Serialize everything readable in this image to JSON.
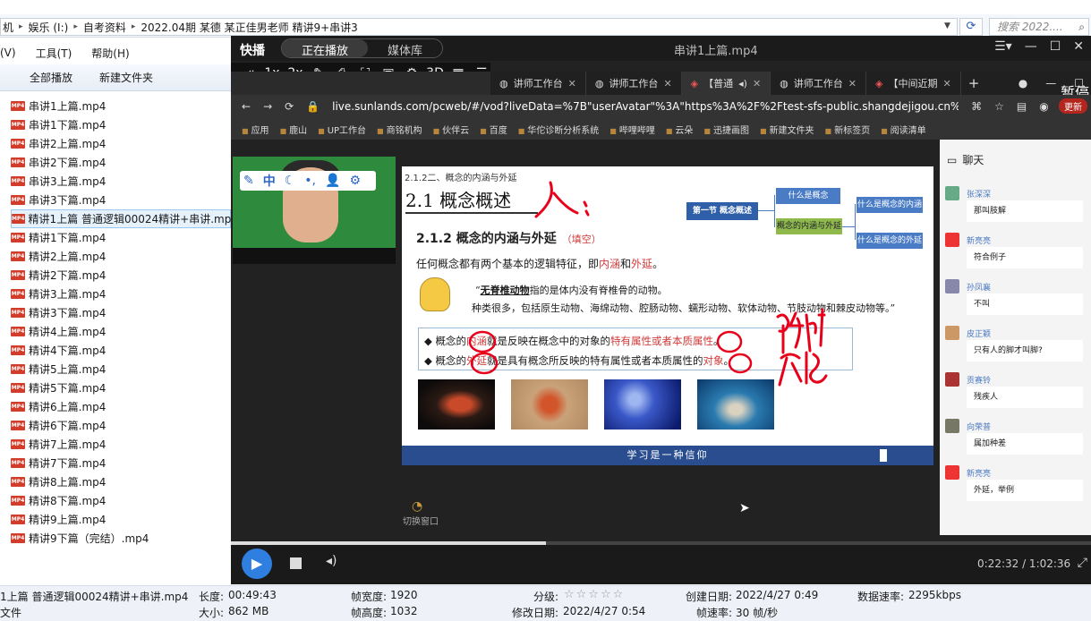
{
  "explorer": {
    "breadcrumbs": [
      "机",
      "娱乐 (I:)",
      "自考资料",
      "2022.04期 某德 某正佳男老师 精讲9+串讲3"
    ],
    "search_placeholder": "搜索 2022....",
    "menu": [
      "(V)",
      "工具(T)",
      "帮助(H)"
    ],
    "toolbar": [
      "全部播放",
      "新建文件夹"
    ],
    "files": [
      "串讲1上篇.mp4",
      "串讲1下篇.mp4",
      "串讲2上篇.mp4",
      "串讲2下篇.mp4",
      "串讲3上篇.mp4",
      "串讲3下篇.mp4",
      "精讲1上篇 普通逻辑00024精讲+串讲.mp4",
      "精讲1下篇.mp4",
      "精讲2上篇.mp4",
      "精讲2下篇.mp4",
      "精讲3上篇.mp4",
      "精讲3下篇.mp4",
      "精讲4上篇.mp4",
      "精讲4下篇.mp4",
      "精讲5上篇.mp4",
      "精讲5下篇.mp4",
      "精讲6上篇.mp4",
      "精讲6下篇.mp4",
      "精讲7上篇.mp4",
      "精讲7下篇.mp4",
      "精讲8上篇.mp4",
      "精讲8下篇.mp4",
      "精讲9上篇.mp4",
      "精讲9下篇（完结）.mp4"
    ],
    "selected_index": 6,
    "file_icon_text": "MP4",
    "details": {
      "name": "1上篇 普通逻辑00024精讲+串讲.mp4",
      "type": "文件",
      "length_label": "长度:",
      "length": "00:49:43",
      "size_label": "大小:",
      "size": "862 MB",
      "width_label": "帧宽度:",
      "width": "1920",
      "height_label": "帧高度:",
      "height": "1032",
      "rating_label": "分级:",
      "rating": "☆☆☆☆☆",
      "modified_label": "修改日期:",
      "modified": "2022/4/27 0:54",
      "created_label": "创建日期:",
      "created": "2022/4/27 0:49",
      "datarate_label": "数据速率:",
      "datarate": "2295kbps",
      "framerate_label": "帧速率:",
      "framerate": "30 帧/秒"
    }
  },
  "player": {
    "brand": "快播",
    "tabs": [
      "正在播放",
      "媒体库"
    ],
    "title": "串讲1上篇.mp4",
    "controls": [
      "⇥",
      "1x",
      "2x",
      "✎",
      "⎙",
      "⛶",
      "▣",
      "⚙",
      "3D",
      "▦",
      "☰"
    ],
    "time": "0:22:32 / 1:02:36",
    "progress": 0.366
  },
  "browser": {
    "tabs": [
      "讲师工作台",
      "讲师工作台",
      "【普通",
      "讲师工作台",
      "【中间近期"
    ],
    "url": "live.sunlands.com/pcweb/#/vod?liveData=%7B\"userAvatar\"%3A\"https%3A%2F%2Ftest-sfs-public.shangdejigou.cn%2Flive_system-20...",
    "update_label": "更新",
    "pause_label": "暂停",
    "bookmarks": [
      "应用",
      "鹿山",
      "UP工作台",
      "商铭机构",
      "伙伴云",
      "百度",
      "华佗诊断分析系统",
      "哔哩哔哩",
      "云朵",
      "迅捷画图",
      "新建文件夹",
      "新标签页",
      "阅读清单"
    ]
  },
  "slide": {
    "section": "2.1.2二、概念的内涵与外延",
    "heading": "2.1 概念概述",
    "subheading": "2.1.2 概念的内涵与外延",
    "fill_note": "（填空）",
    "line1_a": "任何概念都有两个基本的逻辑特征，即",
    "line1_b": "内涵",
    "line1_c": "和",
    "line1_d": "外延",
    "line1_e": "。",
    "quote1_a": "“",
    "quote1_b": "无脊椎动物",
    "quote1_c": "指的是体内没有脊椎骨的动物。",
    "quote2": "种类很多，包括原生动物、海绵动物、腔肠动物、蠕形动物、软体动物、节肢动物和棘皮动物等。”",
    "def1_a": "◆  概念的",
    "def1_b": "内涵",
    "def1_c": "就是反映在概念中的对象的",
    "def1_d": "特有属性或者本质属性",
    "def1_e": "。",
    "def2_a": "◆  概念的",
    "def2_b": "外延",
    "def2_c": "就是具有概念所反映的特有属性或者本质属性的",
    "def2_d": "对象",
    "def2_e": "。",
    "mindmap": {
      "root": "第一节 概念概述",
      "n1": "什么是概念",
      "n2": "概念的内涵与外延",
      "n3": "什么是概念的内涵",
      "n4": "什么是概念的外延"
    },
    "footer": "学习是一种信仰",
    "switch_window": "切换窗口"
  },
  "chat": {
    "title": "聊天",
    "messages": [
      {
        "name": "张深深",
        "text": "那叫肢解"
      },
      {
        "name": "新亮亮",
        "text": "符合例子"
      },
      {
        "name": "孙凤襄",
        "text": "不叫"
      },
      {
        "name": "皮正颖",
        "text": "只有人的脚才叫脚?"
      },
      {
        "name": "贡赛铃",
        "text": "残疾人"
      },
      {
        "name": "向荣普",
        "text": "属加种差"
      },
      {
        "name": "新亮亮",
        "text": "外延，举例"
      }
    ]
  },
  "colors": {
    "accent_blue": "#2f7fe0",
    "slide_red": "#d13b3b",
    "ink_red": "#e8001a",
    "footer_blue": "#2a4d8f"
  }
}
